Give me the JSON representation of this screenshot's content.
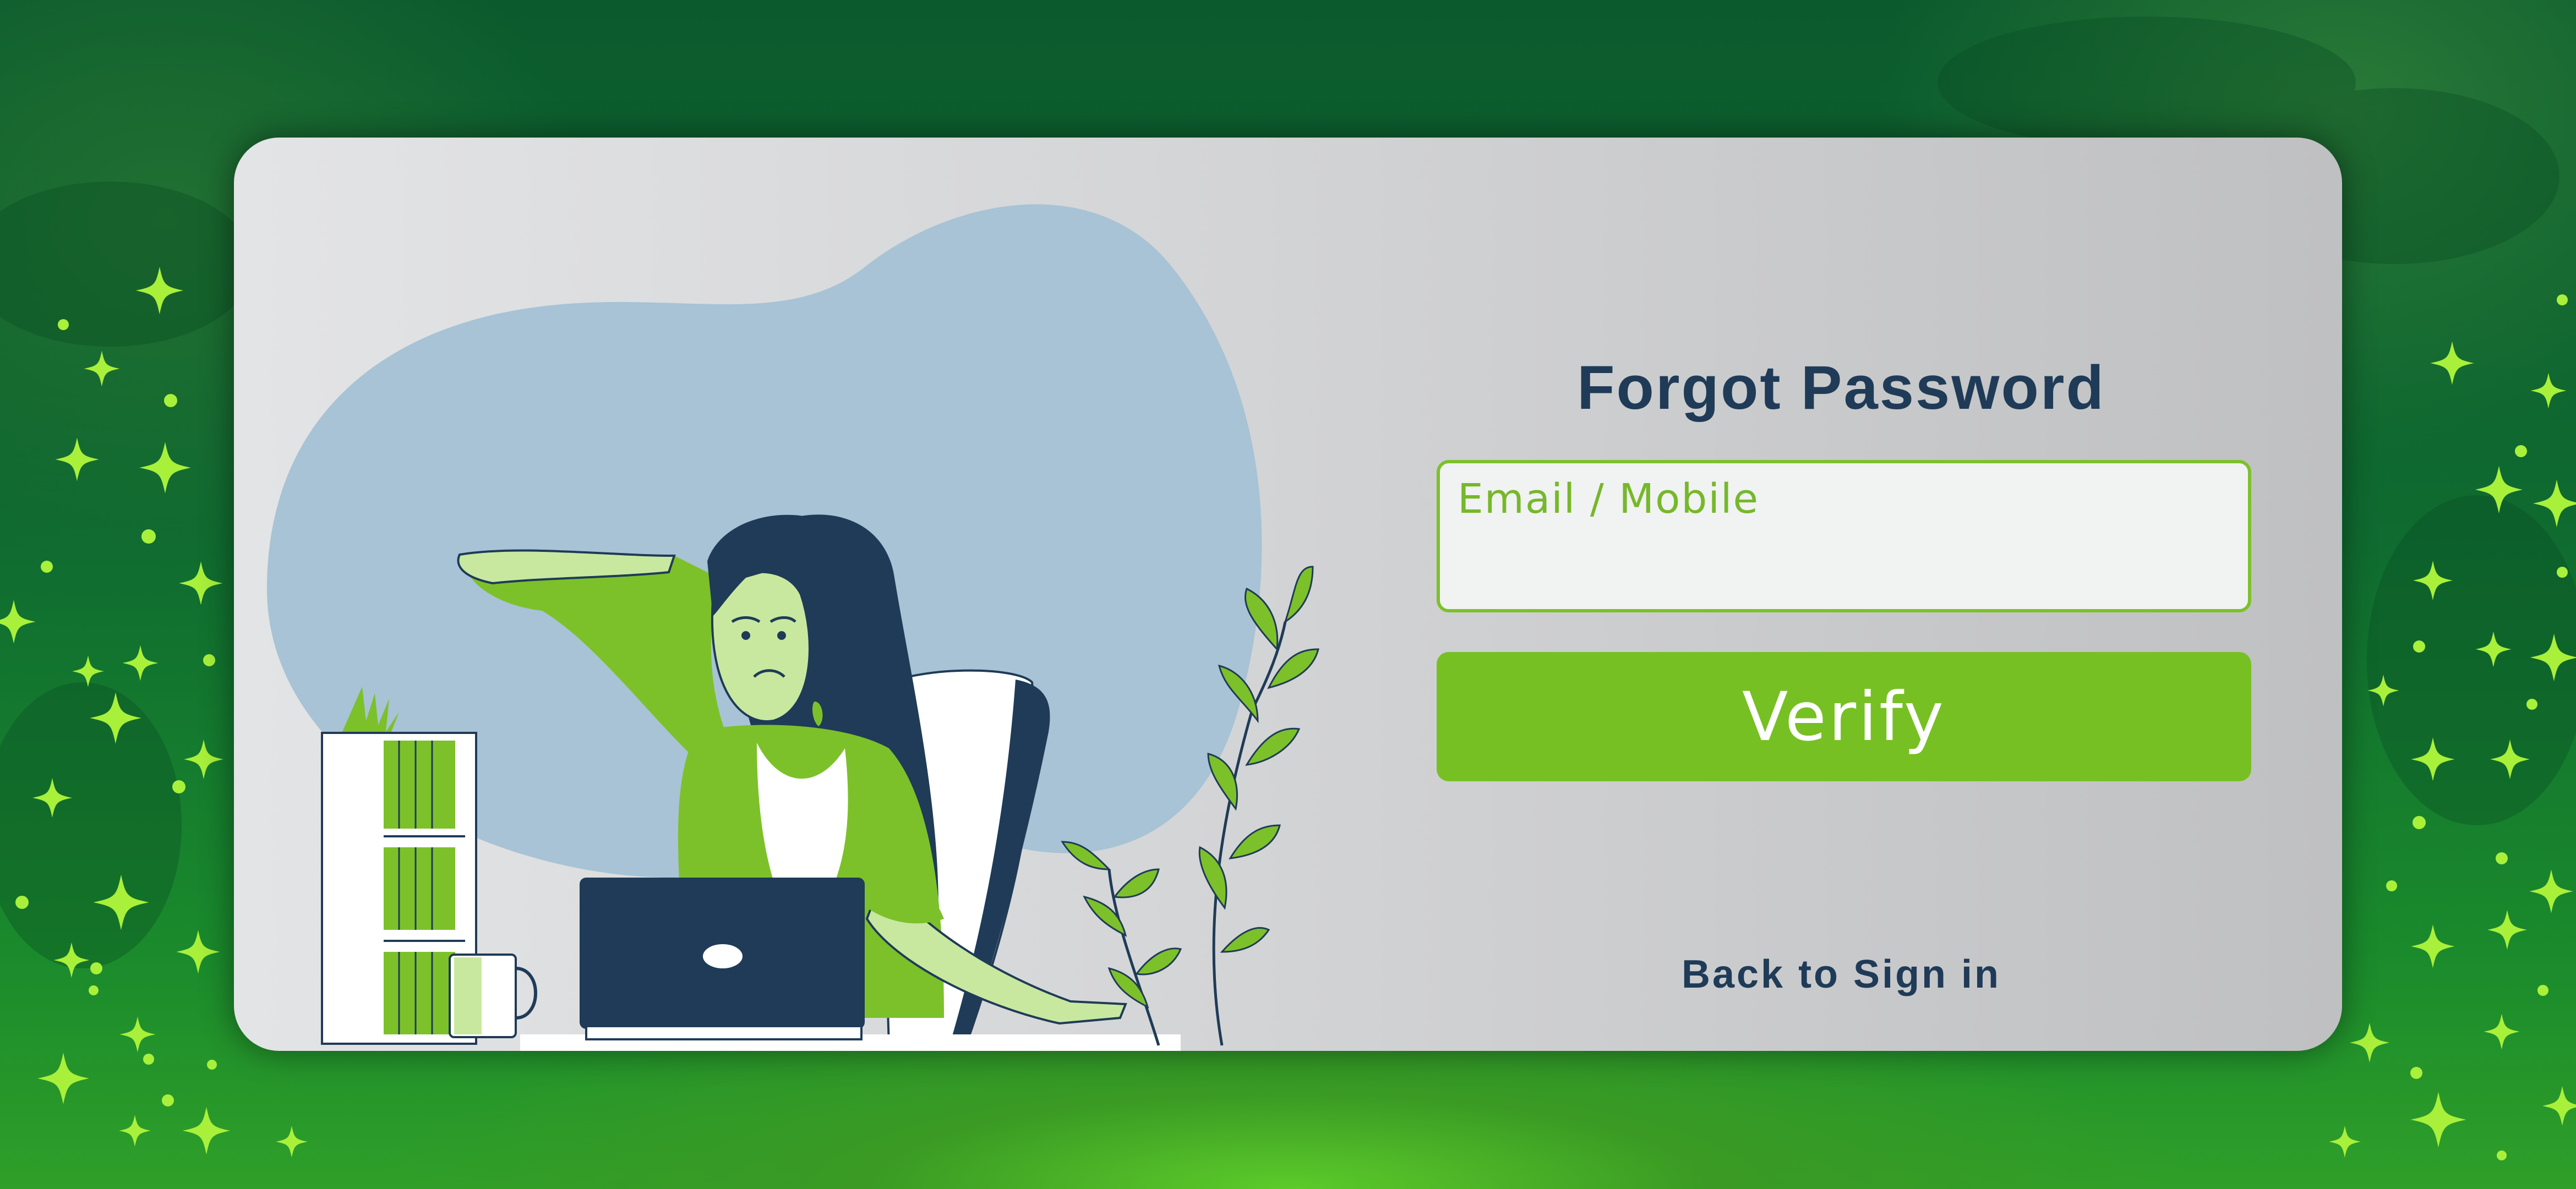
{
  "form": {
    "title": "Forgot Password",
    "input_label": "Email / Mobile",
    "input_value": "",
    "verify_label": "Verify",
    "back_label": "Back to Sign in"
  },
  "colors": {
    "accent": "#77c023",
    "title_text": "#1f3b57",
    "card_background": "#d4d5d7",
    "page_background": "#0f6b30"
  },
  "icons": [
    "sparkle-icon",
    "plant-icon",
    "laptop-icon",
    "mug-icon"
  ]
}
